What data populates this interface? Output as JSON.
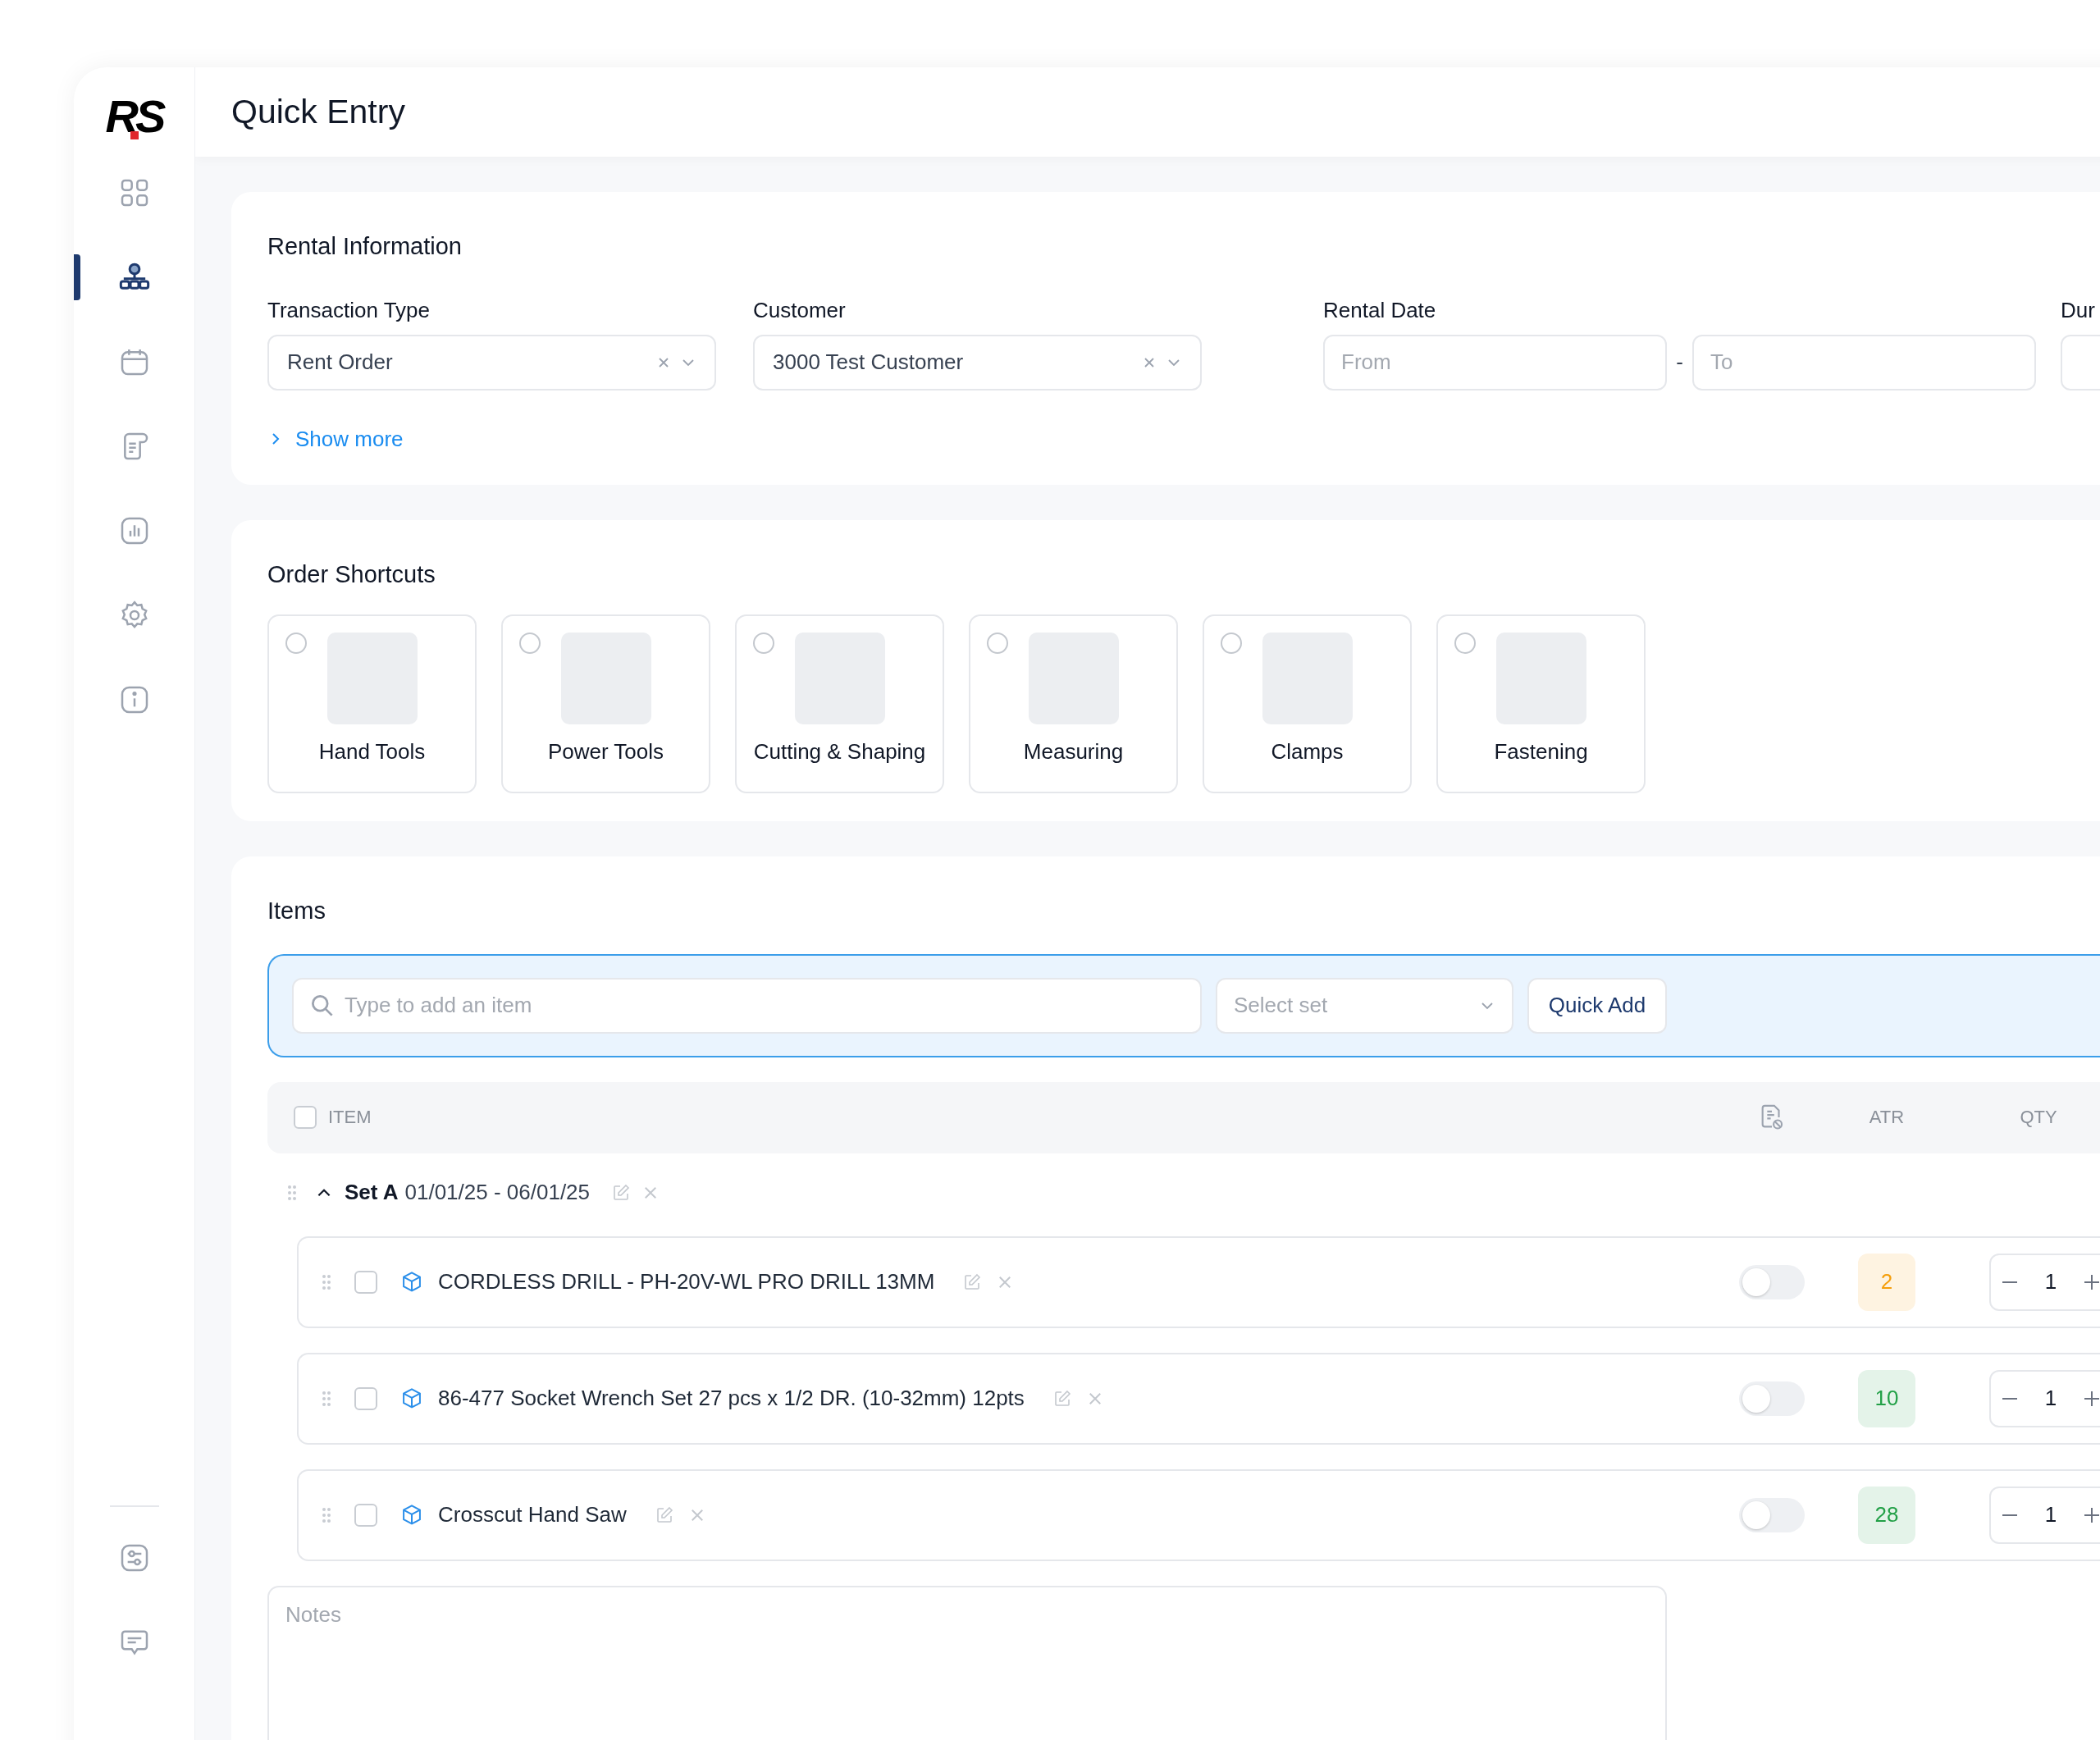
{
  "logo": "RS",
  "sidebar": {
    "nav": [
      {
        "selected": false
      },
      {
        "selected": true
      },
      {
        "selected": false
      },
      {
        "selected": false
      },
      {
        "selected": false
      },
      {
        "selected": false
      },
      {
        "selected": false
      }
    ]
  },
  "header": {
    "title": "Quick Entry"
  },
  "rental_information": {
    "title": "Rental Information",
    "transaction_type": {
      "label": "Transaction Type",
      "value": "Rent Order"
    },
    "customer": {
      "label": "Customer",
      "value": "3000 Test Customer"
    },
    "rental_date": {
      "label": "Rental Date",
      "from_placeholder": "From",
      "separator": "-",
      "to_placeholder": "To"
    },
    "column_4": {
      "label": "Dur"
    },
    "show_more": {
      "label": "Show more",
      "expanded": false
    }
  },
  "order_shortcuts": {
    "title": "Order Shortcuts",
    "items": [
      {
        "label": "Hand Tools",
        "selected": false
      },
      {
        "label": "Power Tools",
        "selected": false
      },
      {
        "label": "Cutting & Shaping",
        "selected": false
      },
      {
        "label": "Measuring",
        "selected": false
      },
      {
        "label": "Clamps",
        "selected": false
      },
      {
        "label": "Fastening",
        "selected": false
      }
    ]
  },
  "items": {
    "title": "Items",
    "search": {
      "placeholder": "Type to add an item"
    },
    "set_select": {
      "placeholder": "Select set"
    },
    "quick_add": "Quick Add",
    "table": {
      "columns": [
        "ITEM",
        "ATR",
        "QTY"
      ],
      "all_checked": false
    },
    "sets": [
      {
        "name": "Set A",
        "dates": "01/01/25 - 06/01/25",
        "expanded": true,
        "rows": [
          {
            "name": "CORDLESS DRILL - PH-20V-WL PRO DRILL 13MM",
            "checked": false,
            "on": false,
            "atr": "2",
            "color": "#f59e0b",
            "qty": "1"
          },
          {
            "name": "86-477 Socket Wrench Set 27 pcs x 1/2 DR. (10-32mm) 12pts",
            "checked": false,
            "on": false,
            "atr": "10",
            "color": "#22a047",
            "qty": "1"
          },
          {
            "name": "Crosscut Hand Saw",
            "checked": false,
            "on": false,
            "atr": "28",
            "color": "#22a047",
            "qty": "1"
          }
        ]
      }
    ],
    "notes": {
      "placeholder": "Notes"
    }
  }
}
